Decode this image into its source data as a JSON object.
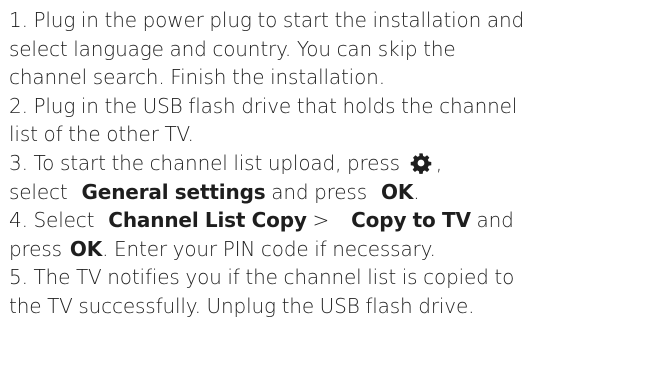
{
  "steps": [
    {
      "lines": [
        "1. Plug in the power plug to start the installation and",
        "select language and country. You can skip the",
        "channel search. Finish the installation."
      ]
    },
    {
      "lines": [
        "2. Plug in the USB flash drive that holds the channel",
        "list of the other TV."
      ]
    },
    {
      "line1_text": "3. To start the channel list upload, press",
      "line1_after_icon": ",",
      "line2_pre": "select",
      "line2_bold1": "General settings",
      "line2_mid": "and press",
      "line2_bold2": "OK",
      "line2_end": ".",
      "icon": "gear-icon"
    },
    {
      "line1_pre": "4. Select",
      "line1_bold1": "Channel List Copy",
      "line1_sep": ">",
      "line1_bold2": "Copy to TV",
      "line1_end": "and",
      "line2_pre": "press",
      "line2_bold": "OK",
      "line2_end": ". Enter your PIN code if necessary."
    },
    {
      "lines": [
        "5. The TV notifies you if the channel list is copied to",
        "the TV successfully. Unplug the USB flash drive."
      ]
    }
  ],
  "colors": {
    "text": "#1e1e1e",
    "background": "#ffffff"
  }
}
